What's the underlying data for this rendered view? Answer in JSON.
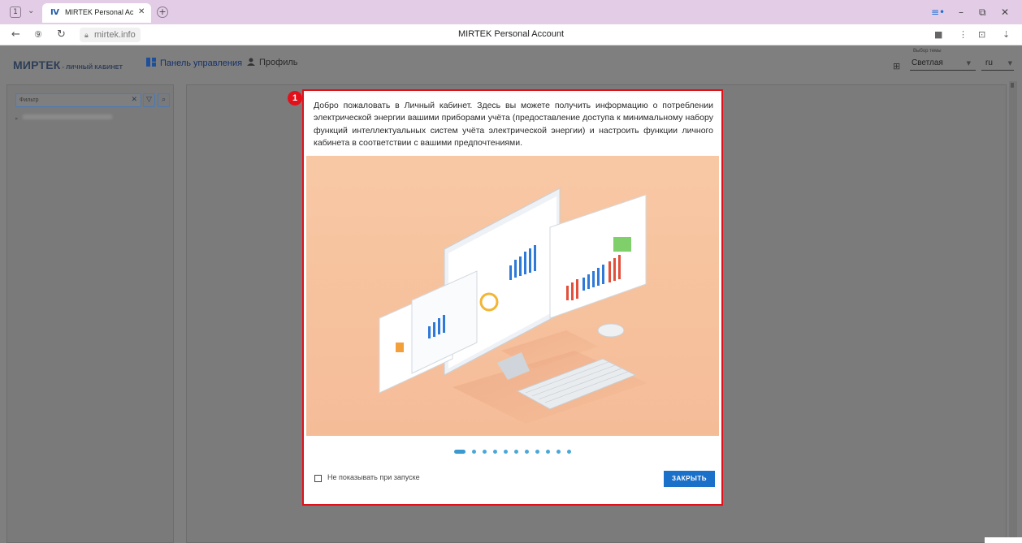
{
  "browser": {
    "tab_count": "1",
    "tab_title": "MIRTEK Personal Acco",
    "url": "mirtek.info",
    "page_title": "MIRTEK Personal Account"
  },
  "header": {
    "logo": "МИРТЕК",
    "logo_sub": "- личный кабинет",
    "nav_dashboard": "Панель управления",
    "nav_profile": "Профиль",
    "theme_label": "Выбор темы",
    "theme_value": "Светлая",
    "lang_value": "ru"
  },
  "sidebar": {
    "filter_placeholder": "Фильтр"
  },
  "dialog": {
    "badge": "1",
    "text": "Добро пожаловать в Личный кабинет. Здесь вы можете получить информацию о потреблении электрической энергии вашими приборами учёта (предоставление доступа к минимальному набору функций интеллектуальных систем учёта электрической энергии) и настроить функции личного кабинета в соответствии с вашими предпочтениями.",
    "slides_total": 11,
    "slide_active": 1,
    "checkbox_label": "Не показывать при запуске",
    "close_label": "ЗАКРЫТЬ"
  },
  "colors": {
    "accent": "#1b70c9",
    "highlight": "#e3101a",
    "tab_strip": "#e3cde6"
  }
}
